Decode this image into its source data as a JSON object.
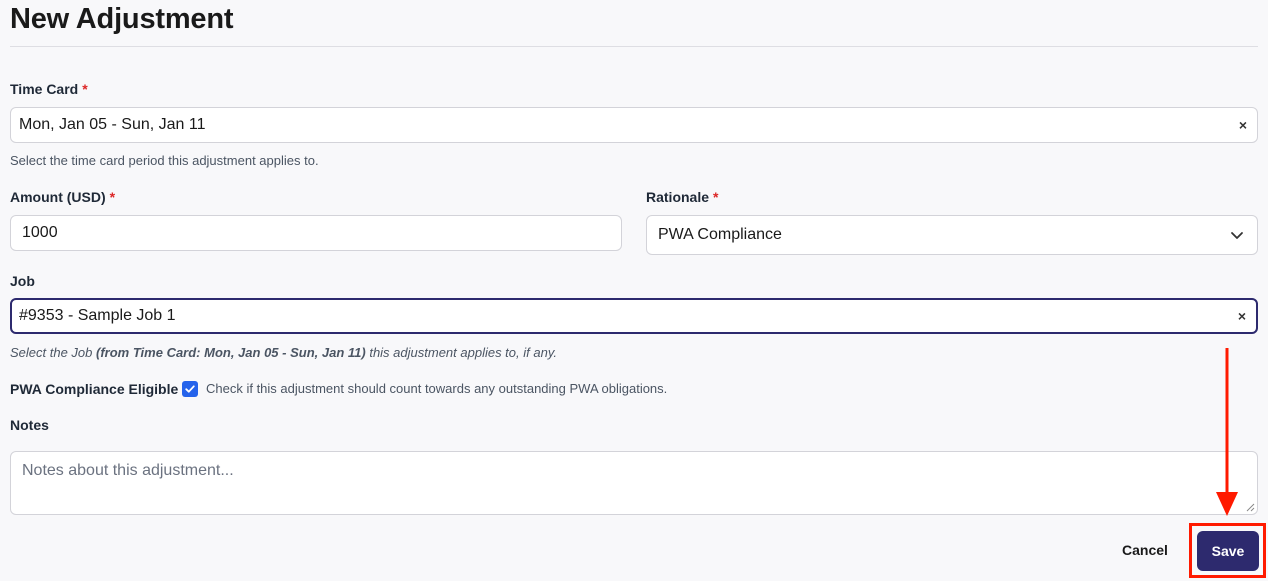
{
  "page": {
    "title": "New Adjustment"
  },
  "time_card": {
    "label": "Time Card",
    "required_mark": "*",
    "value": "Mon, Jan 05 - Sun, Jan 11",
    "clear_glyph": "×",
    "help": "Select the time card period this adjustment applies to."
  },
  "amount": {
    "label": "Amount (USD)",
    "required_mark": "*",
    "value": "1000"
  },
  "rationale": {
    "label": "Rationale",
    "required_mark": "*",
    "selected": "PWA Compliance"
  },
  "job": {
    "label": "Job",
    "value": "#9353 - Sample Job 1",
    "clear_glyph": "×",
    "help_prefix": "Select the Job",
    "help_bold": "(from Time Card: Mon, Jan 05 - Sun, Jan 11)",
    "help_suffix": "this adjustment applies to, if any."
  },
  "pwa": {
    "label": "PWA Compliance Eligible",
    "checked": true,
    "help": "Check if this adjustment should count towards any outstanding PWA obligations."
  },
  "notes": {
    "label": "Notes",
    "placeholder": "Notes about this adjustment..."
  },
  "actions": {
    "cancel_label": "Cancel",
    "save_label": "Save"
  },
  "colors": {
    "primary": "#2d2a6e",
    "required": "#dc2626",
    "checkbox": "#2563eb",
    "annotation": "#ff1a00"
  }
}
